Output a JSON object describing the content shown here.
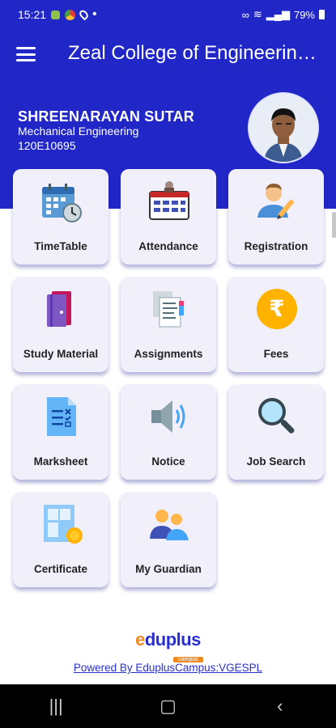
{
  "status": {
    "time": "15:21",
    "battery": "79%"
  },
  "header": {
    "title": "Zeal College of Engineering and Research"
  },
  "student": {
    "name": "SHREENARAYAN SUTAR",
    "branch": "Mechanical Engineering",
    "id": "120E10695"
  },
  "menu": [
    {
      "label": "TimeTable",
      "icon": "calendar-clock-icon"
    },
    {
      "label": "Attendance",
      "icon": "attendance-register-icon"
    },
    {
      "label": "Registration",
      "icon": "user-pencil-icon"
    },
    {
      "label": "Study Material",
      "icon": "books-icon"
    },
    {
      "label": "Assignments",
      "icon": "documents-icon"
    },
    {
      "label": "Fees",
      "icon": "rupee-icon"
    },
    {
      "label": "Marksheet",
      "icon": "marksheet-icon"
    },
    {
      "label": "Notice",
      "icon": "speaker-icon"
    },
    {
      "label": "Job Search",
      "icon": "magnifier-icon"
    },
    {
      "label": "Certificate",
      "icon": "certificate-icon"
    },
    {
      "label": "My Guardian",
      "icon": "guardian-icon"
    }
  ],
  "footer": {
    "brand": "eduplus",
    "brand_sub": "campus",
    "powered": "Powered By EduplusCampus:VGESPL"
  },
  "colors": {
    "primary": "#2127c6",
    "tile": "#f1f0fa",
    "accent_orange": "#f08a1d"
  }
}
